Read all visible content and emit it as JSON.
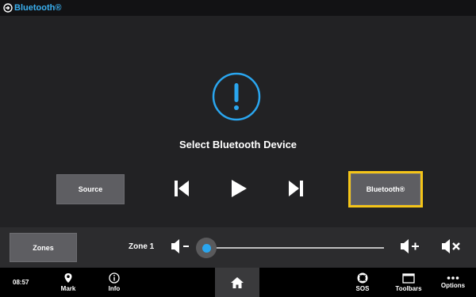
{
  "app": {
    "title": "Bluetooth®"
  },
  "status": {
    "message": "Select Bluetooth Device"
  },
  "controls": {
    "source_label": "Source",
    "bluetooth_label": "Bluetooth®"
  },
  "zone": {
    "zones_label": "Zones",
    "name": "Zone 1",
    "volume_fraction": 0.0
  },
  "bottom": {
    "time": "08:57",
    "nav": [
      {
        "label": "Mark",
        "icon": "pin-icon"
      },
      {
        "label": "Info",
        "icon": "info-icon"
      },
      {
        "label": "SOS",
        "icon": "lifebuoy-icon"
      },
      {
        "label": "Toolbars",
        "icon": "toolbars-icon"
      },
      {
        "label": "Options",
        "icon": "dots-icon"
      }
    ]
  },
  "colors": {
    "accent": "#3ab0f0",
    "highlight": "#f5c518",
    "background": "#222224"
  }
}
